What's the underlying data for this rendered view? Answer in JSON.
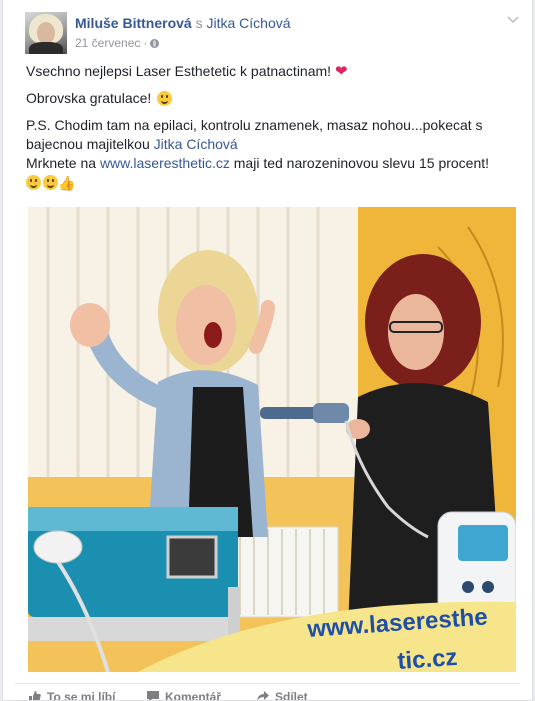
{
  "post": {
    "author": "Miluše Bittnerová",
    "with_word": "s",
    "tagged": "Jitka Cíchová",
    "date": "21 červenec",
    "meta_separator": "·",
    "line1": "Vsechno nejlepsi Laser Esthetetic k patnactinam!",
    "line2": "Obrovska gratulace!",
    "ps_text": "P.S. Chodim tam na epilaci, kontrolu znamenek, masaz nohou...pokecat s bajecnou majitelkou ",
    "ps_mention": "Jitka Cíchová",
    "mrknete_prefix": "Mrknete na ",
    "website": "www.laseresthetic.cz",
    "mrknete_suffix": " maji ted narozeninovou slevu 15 procent!",
    "photo_text_line1": "www.laseresthe",
    "photo_text_line2": "tic.cz"
  },
  "icons": {
    "heart": "❤",
    "thumb": "👍",
    "globe": "globe-icon",
    "chevron": "chevron-down-icon"
  },
  "actions": {
    "like": "To se mi líbí",
    "comment": "Komentář",
    "share": "Sdílet"
  },
  "colors": {
    "link": "#365899",
    "meta": "#90949c",
    "heart": "#e0245e"
  }
}
